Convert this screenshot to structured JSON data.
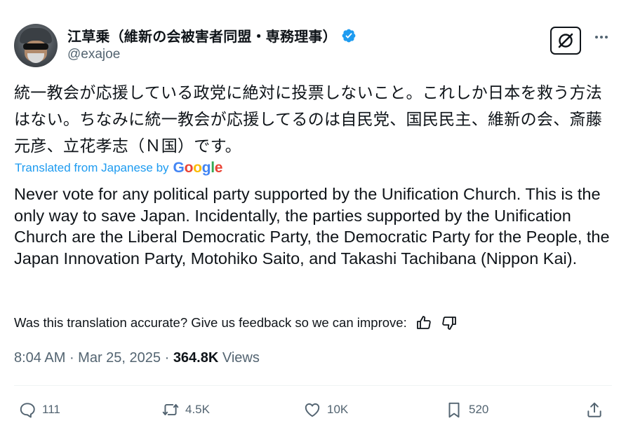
{
  "tweet": {
    "display_name": "江草乗（維新の会被害者同盟・専務理事）",
    "handle": "@exajoe",
    "original_text": "統一教会が応援している政党に絶対に投票しないこと。これしか日本を救う方法はない。ちなみに統一教会が応援してるのは自民党、国民民主、維新の会、斎藤元彦、立花孝志（Ｎ国）です。",
    "translated_label": "Translated from Japanese by",
    "translator": "Google",
    "translated_text": "Never vote for any political party supported by the Unification Church. This is the only way to save Japan. Incidentally, the parties supported by the Unification Church are the Liberal Democratic Party, the Democratic Party for the People, the Japan Innovation Party, Motohiko Saito, and Takashi Tachibana (Nippon Kai).",
    "feedback_prompt": "Was this translation accurate? Give us feedback so we can improve:",
    "time": "8:04 AM",
    "date": "Mar 25, 2025",
    "separator": " · ",
    "views_count": "364.8K",
    "views_label": "Views"
  },
  "actions": {
    "replies": "111",
    "reposts": "4.5K",
    "likes": "10K",
    "bookmarks": "520"
  },
  "colors": {
    "link_blue": "#1d9bf0",
    "secondary_text": "#536471",
    "primary_text": "#0f1419"
  },
  "icons": [
    "avatar",
    "verified-badge-icon",
    "grok-icon",
    "more-icon",
    "thumbs-up-icon",
    "thumbs-down-icon",
    "reply-icon",
    "repost-icon",
    "like-icon",
    "bookmark-icon",
    "share-icon"
  ]
}
